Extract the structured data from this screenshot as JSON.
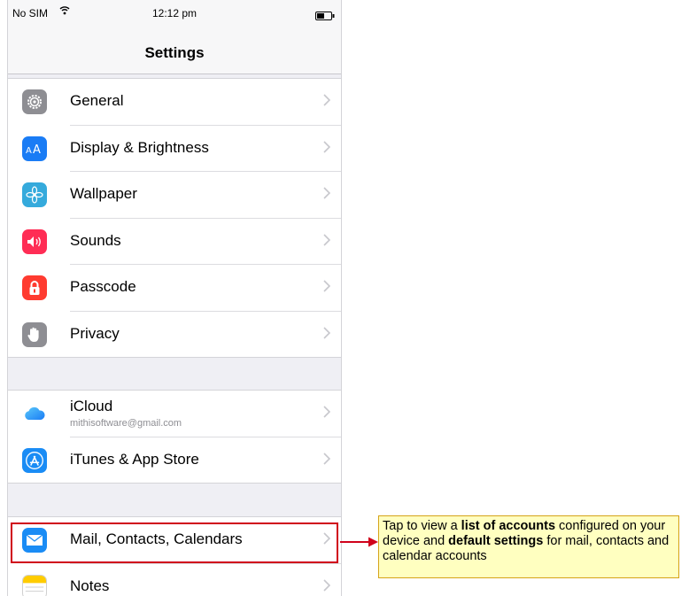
{
  "status_bar": {
    "carrier": "No SIM",
    "time": "12:12 pm"
  },
  "nav": {
    "title": "Settings"
  },
  "groups": [
    {
      "items": [
        {
          "label": "General",
          "icon": "gear-icon",
          "color": "#8e8e93"
        },
        {
          "label": "Display & Brightness",
          "icon": "text-size-icon",
          "color": "#1a7cf5"
        },
        {
          "label": "Wallpaper",
          "icon": "flower-icon",
          "color": "#35aadc"
        },
        {
          "label": "Sounds",
          "icon": "speaker-icon",
          "color": "#ff2d55"
        },
        {
          "label": "Passcode",
          "icon": "lock-icon",
          "color": "#ff3b30"
        },
        {
          "label": "Privacy",
          "icon": "hand-icon",
          "color": "#8e8e93"
        }
      ]
    },
    {
      "items": [
        {
          "label": "iCloud",
          "sublabel": "mithisoftware@gmail.com",
          "icon": "cloud-icon",
          "color": "#ffffff"
        },
        {
          "label": "iTunes & App Store",
          "icon": "app-store-icon",
          "color": "#1a8cf5"
        }
      ]
    },
    {
      "items": [
        {
          "label": "Mail, Contacts, Calendars",
          "icon": "mail-icon",
          "color": "#1a8cf5"
        },
        {
          "label": "Notes",
          "icon": "notes-icon",
          "color": "#ffcc00"
        }
      ]
    }
  ],
  "callout": {
    "t1": "Tap to view a ",
    "b1": "list of accounts",
    "t2": " configured on your device and ",
    "b2": "default settings",
    "t3": " for mail, contacts and calendar accounts"
  },
  "colors": {
    "highlight": "#d0021b",
    "callout_bg": "#ffffc0"
  }
}
